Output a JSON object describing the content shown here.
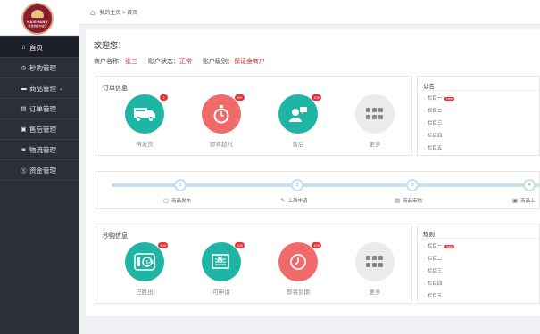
{
  "logo": {
    "text": "KAISHANU",
    "subtext": "凯世纳欧洲进口"
  },
  "sidebar": {
    "items": [
      {
        "label": "首页",
        "icon": "home-icon",
        "glyph": "⌂"
      },
      {
        "label": "秒购管理",
        "icon": "clock-icon",
        "glyph": "◷"
      },
      {
        "label": "商品管理",
        "icon": "folder-icon",
        "glyph": "▬",
        "caret": "⌄"
      },
      {
        "label": "订单管理",
        "icon": "order-icon",
        "glyph": "▤"
      },
      {
        "label": "售后管理",
        "icon": "aftersale-icon",
        "glyph": "▣"
      },
      {
        "label": "物流管理",
        "icon": "truck-icon",
        "glyph": "◙"
      },
      {
        "label": "资金管理",
        "icon": "money-icon",
        "glyph": "Ⓢ"
      }
    ]
  },
  "breadcrumb": "我的主页 > 首页",
  "welcome": "欢迎您！",
  "merchant": {
    "name_label": "商户名称：",
    "name": "张三",
    "status_label": "账户状态：",
    "status": "正常",
    "level_label": "账户级别：",
    "level": "保证金商户"
  },
  "orders": {
    "title": "订单信息",
    "tiles": [
      {
        "label": "待发货",
        "badge": "1"
      },
      {
        "label": "即将超时",
        "badge": "99+"
      },
      {
        "label": "售后",
        "badge": "100"
      },
      {
        "label": "更多",
        "badge": ""
      }
    ]
  },
  "notice": {
    "title": "公告",
    "items": [
      "栏目一",
      "栏目二",
      "栏目三",
      "栏目四",
      "栏目五"
    ],
    "new_badge": "new"
  },
  "steps": {
    "items": [
      {
        "num": "1",
        "label": "商品发布"
      },
      {
        "num": "2",
        "label": "上架申请"
      },
      {
        "num": "3",
        "label": "商品审核"
      },
      {
        "num": "4",
        "label": "商品上"
      }
    ]
  },
  "flash": {
    "title": "秒购信息",
    "tiles": [
      {
        "label": "已胜出",
        "badge": "100"
      },
      {
        "label": "可申请",
        "badge": "100"
      },
      {
        "label": "即将到期",
        "badge": "100"
      },
      {
        "label": "更多",
        "badge": ""
      }
    ]
  },
  "rules": {
    "title": "规则",
    "items": [
      "栏目一",
      "栏目二",
      "栏目三",
      "栏目四",
      "栏目五"
    ],
    "new_badge": "new"
  },
  "colors": {
    "sidebar_bg": "#2b2f3a",
    "teal": "#1fb5a4",
    "coral": "#f16a6a",
    "accent_red": "#e02b2b",
    "track": "#c9dff0"
  }
}
